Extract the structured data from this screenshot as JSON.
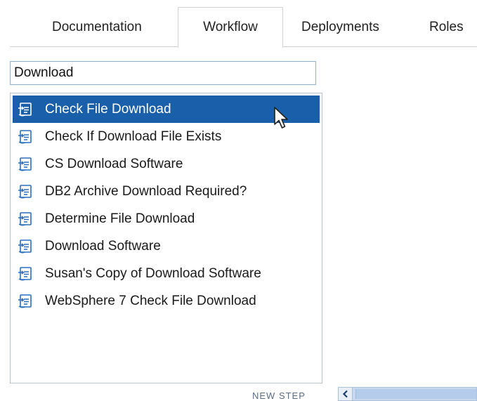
{
  "tabs": [
    {
      "label": "Documentation",
      "active": false
    },
    {
      "label": "Workflow",
      "active": true
    },
    {
      "label": "Deployments",
      "active": false
    },
    {
      "label": "Roles",
      "active": false
    }
  ],
  "search": {
    "value": "Download"
  },
  "list": {
    "selected_index": 0,
    "item_icon": "workflow-step-icon",
    "items": [
      {
        "label": "Check File Download"
      },
      {
        "label": "Check If Download File Exists"
      },
      {
        "label": "CS Download Software"
      },
      {
        "label": "DB2 Archive Download Required?"
      },
      {
        "label": "Determine File Download"
      },
      {
        "label": "Download Software"
      },
      {
        "label": "Susan's Copy of Download Software"
      },
      {
        "label": "WebSphere 7 Check File Download"
      }
    ]
  },
  "footer": {
    "new_step_label": "NEW STEP"
  },
  "colors": {
    "selection": "#1a5fa9",
    "accent_border": "#8faed1",
    "icon_blue": "#2a6fc0"
  }
}
